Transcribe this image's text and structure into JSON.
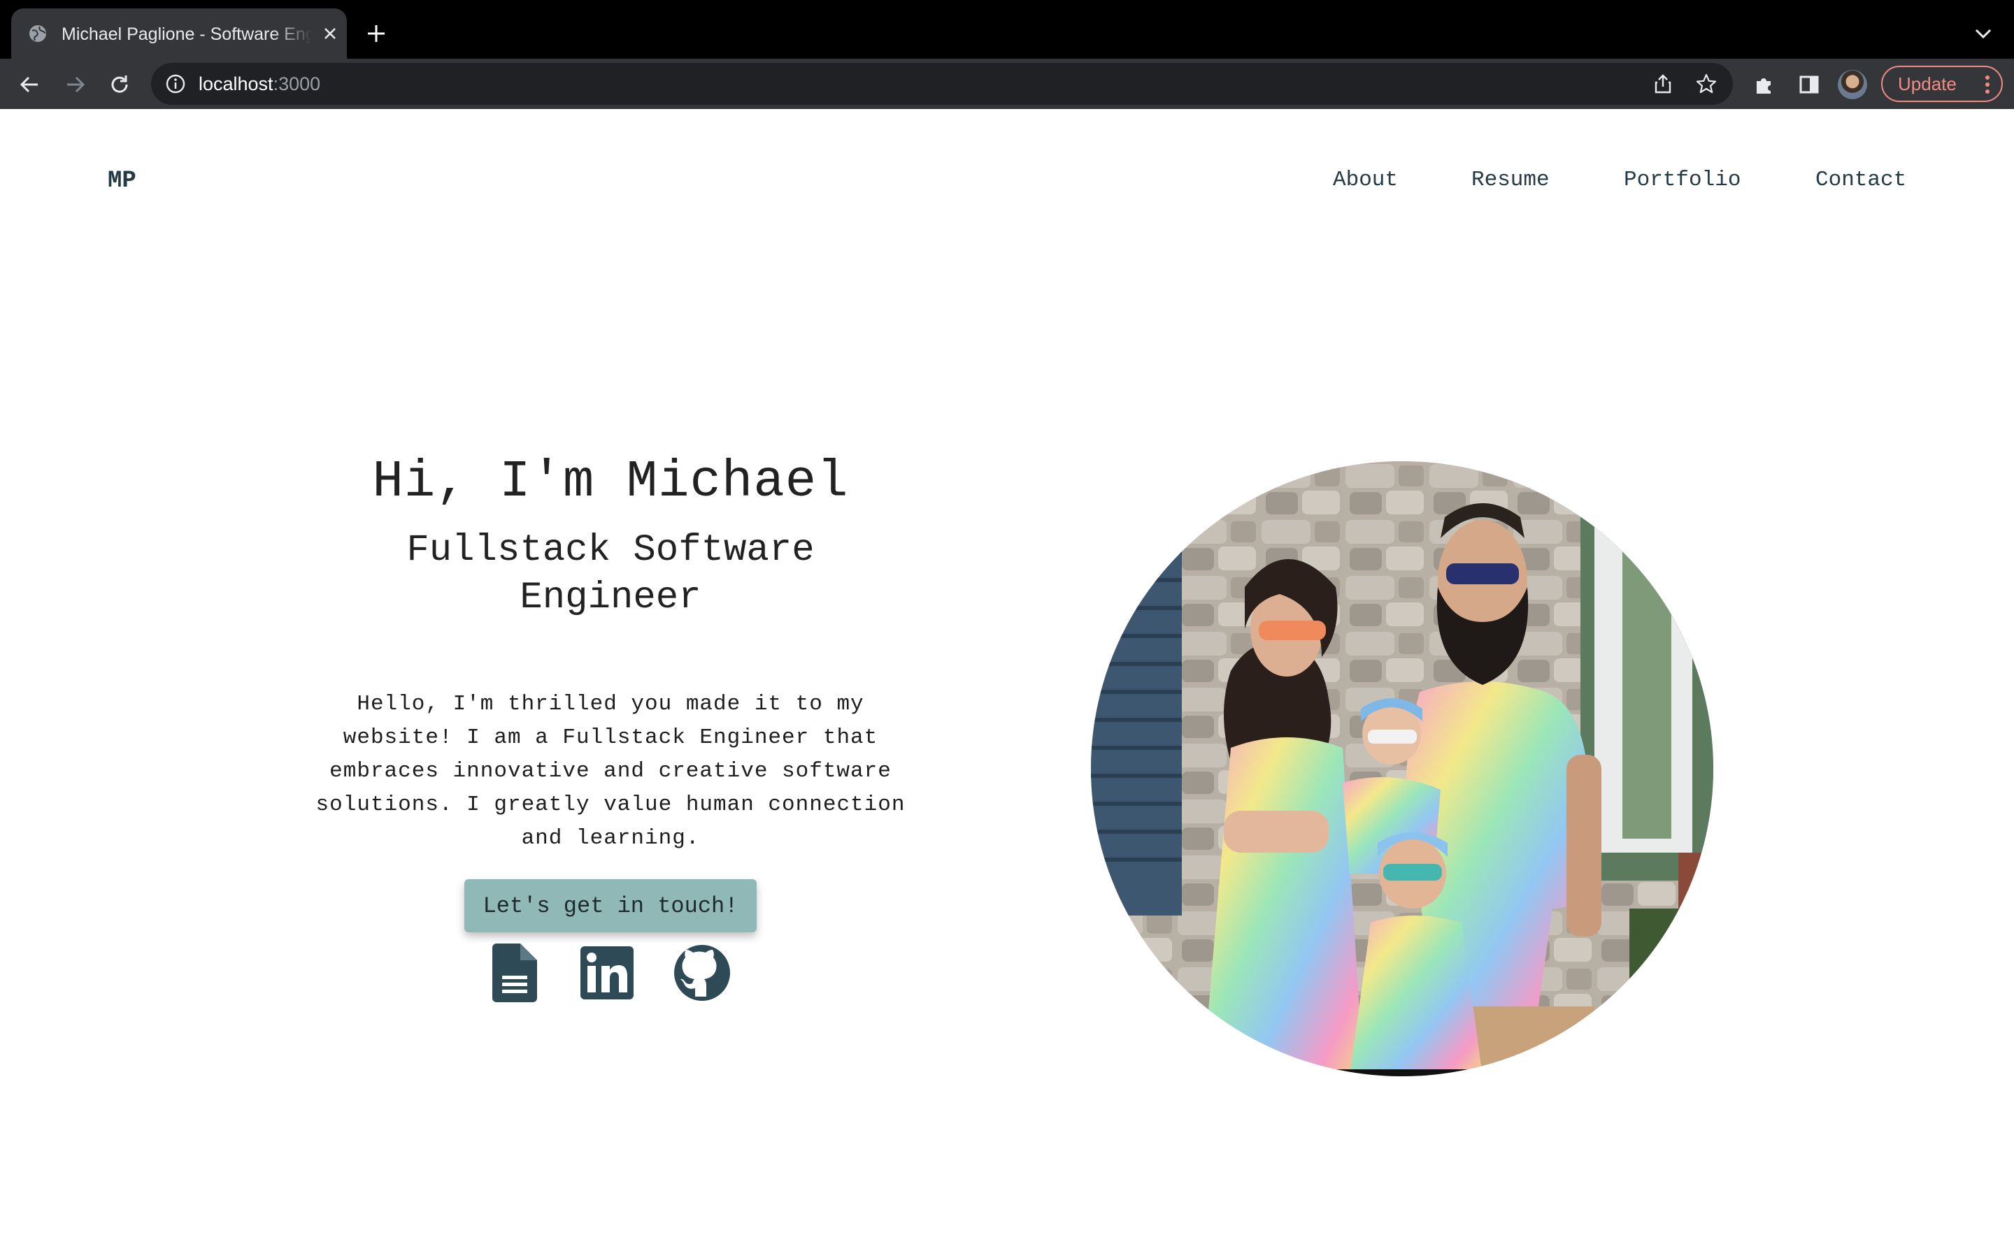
{
  "browser": {
    "tab_title": "Michael Paglione - Software Engineer",
    "url_host": "localhost",
    "url_port": ":3000",
    "update_label": "Update"
  },
  "site": {
    "brand": "MP",
    "nav": [
      "About",
      "Resume",
      "Portfolio",
      "Contact"
    ]
  },
  "hero": {
    "title": "Hi, I'm Michael",
    "subtitle": "Fullstack Software Engineer",
    "intro": "Hello, I'm thrilled you made it to my website! I am a Fullstack Engineer that embraces innovative and creative software solutions. I greatly value human connection and learning.",
    "cta_label": "Let's get in touch!"
  },
  "social_icons": [
    "document-icon",
    "linkedin-icon",
    "github-icon"
  ],
  "colors": {
    "accent": "#8fb8b6",
    "text_dark": "#243b45",
    "update_red": "#f28b82"
  }
}
